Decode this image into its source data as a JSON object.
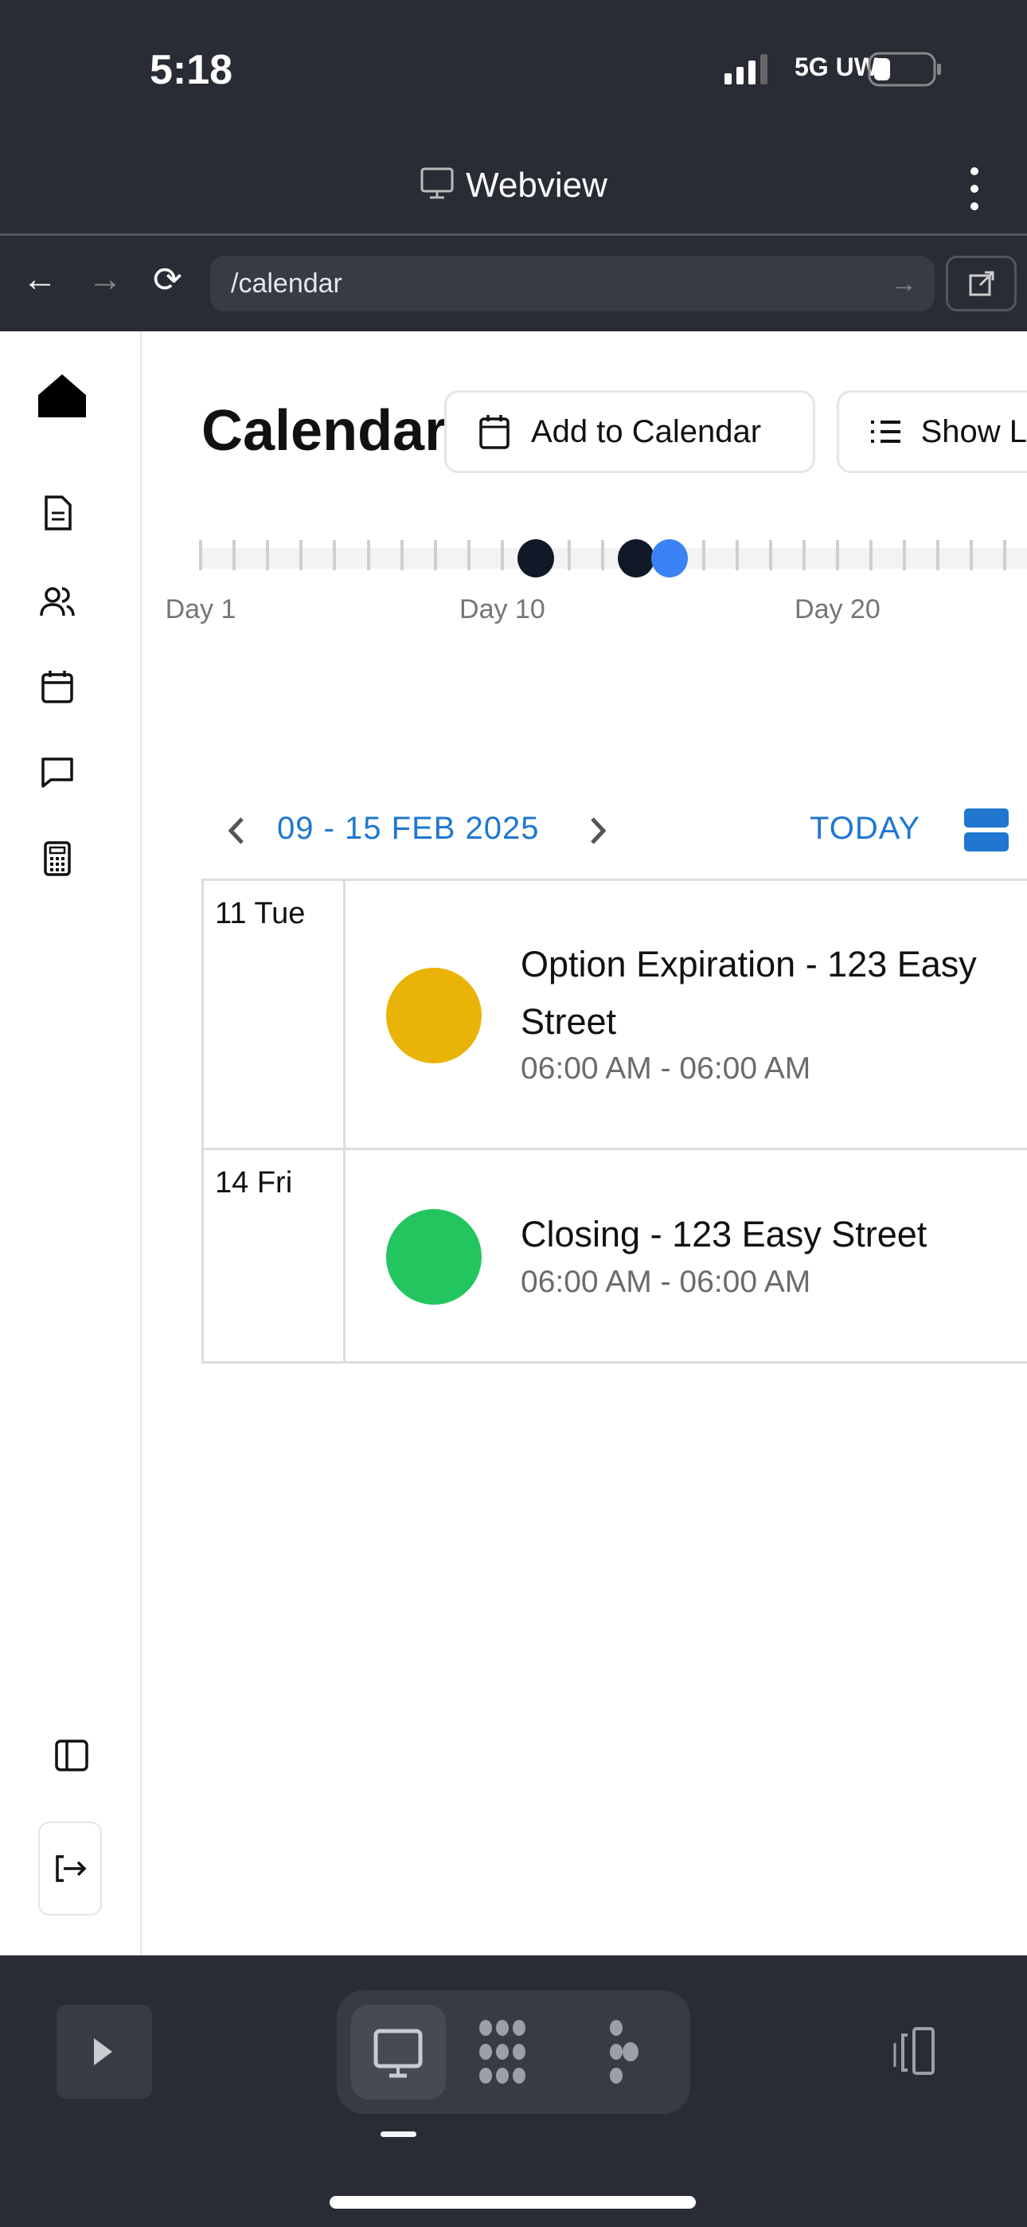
{
  "status": {
    "time": "5:18",
    "network": "5G UW"
  },
  "header": {
    "title": "Webview",
    "url": "/calendar"
  },
  "sidebar": {
    "icons": [
      "home-icon",
      "document-icon",
      "users-icon",
      "calendar-icon",
      "chat-icon",
      "calculator-icon"
    ],
    "panel_icon": "sidebar-panel-icon",
    "logout_icon": "logout-icon"
  },
  "page": {
    "title": "Calendar",
    "add_button": "Add to Calendar",
    "show_button": "Show L"
  },
  "timeline": {
    "total_days": 28,
    "labels": [
      {
        "day": 1,
        "text": "Day 1"
      },
      {
        "day": 10,
        "text": "Day 10"
      },
      {
        "day": 20,
        "text": "Day 20"
      }
    ],
    "events": [
      {
        "day": 11,
        "color": "#111827"
      },
      {
        "day": 14,
        "color": "#111827"
      },
      {
        "day": 15,
        "color": "#3b82f6"
      }
    ]
  },
  "week": {
    "range": "09 - 15 FEB 2025",
    "today": "TODAY"
  },
  "events": [
    {
      "date": "11 Tue",
      "title": "Option Expiration - 123 Easy Street",
      "time": "06:00 AM - 06:00 AM",
      "color": "#eab308"
    },
    {
      "date": "14 Fri",
      "title": "Closing - 123 Easy Street",
      "time": "06:00 AM - 06:00 AM",
      "color": "#22c55e"
    }
  ],
  "colors": {
    "accent": "#1f77d0",
    "chrome": "#292c34"
  }
}
